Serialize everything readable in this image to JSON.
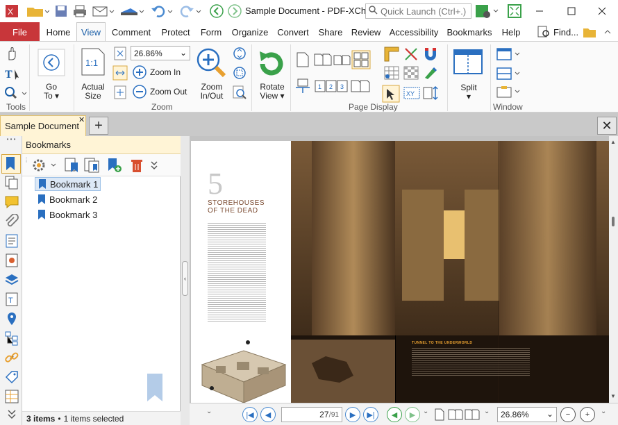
{
  "window": {
    "title": "Sample Document - PDF-XCha...",
    "quick_launch_placeholder": "Quick Launch (Ctrl+.)"
  },
  "menu": {
    "file": "File",
    "tabs": [
      "Home",
      "View",
      "Comment",
      "Protect",
      "Form",
      "Organize",
      "Convert",
      "Share",
      "Review",
      "Accessibility",
      "Bookmarks",
      "Help"
    ],
    "active": "View",
    "find": "Find..."
  },
  "ribbon": {
    "tools_label": "Tools",
    "goto_line1": "Go",
    "goto_line2": "To",
    "actual_line1": "Actual",
    "actual_line2": "Size",
    "zoom_value": "26.86%",
    "zoom_in": "Zoom In",
    "zoom_out": "Zoom Out",
    "zoominout_line1": "Zoom",
    "zoominout_line2": "In/Out",
    "zoom_label": "Zoom",
    "rotate_line1": "Rotate",
    "rotate_line2": "View",
    "page_display_label": "Page Display",
    "split": "Split",
    "window_label": "Window"
  },
  "tabs": {
    "document": "Sample Document"
  },
  "bookmarks": {
    "title": "Bookmarks",
    "items": [
      "Bookmark 1",
      "Bookmark 2",
      "Bookmark 3"
    ],
    "status_count": "3 items",
    "status_selected": "1 items selected"
  },
  "page_content": {
    "chapter_number": "5",
    "chapter_title_line1": "STOREHOUSES",
    "chapter_title_line2": "OF THE DEAD",
    "caption_right": "TUNNEL TO THE UNDERWORLD"
  },
  "navigation": {
    "current_page": "27",
    "total_pages": "91",
    "zoom": "26.86%"
  },
  "colors": {
    "file_tab": "#c8363a",
    "accent": "#1b5fa8",
    "panel_header": "#fff4d6"
  }
}
